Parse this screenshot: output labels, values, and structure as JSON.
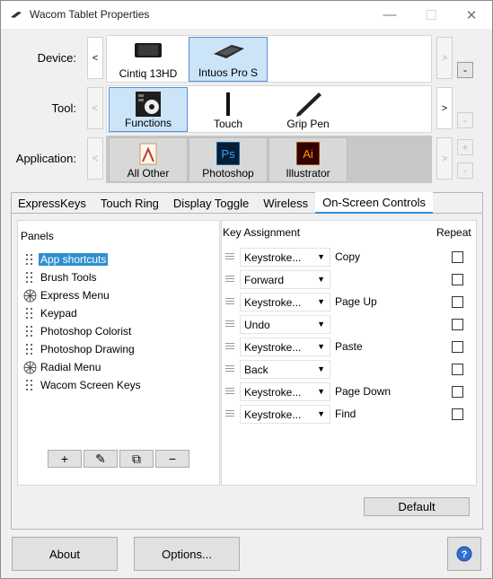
{
  "window": {
    "title": "Wacom Tablet Properties"
  },
  "labels": {
    "device": "Device:",
    "tool": "Tool:",
    "application": "Application:"
  },
  "devices": [
    {
      "label": "Cintiq 13HD",
      "icon": "cintiq-icon",
      "selected": false
    },
    {
      "label": "Intuos Pro S",
      "icon": "intuos-icon",
      "selected": true
    }
  ],
  "tools": [
    {
      "label": "Functions",
      "icon": "functions-icon",
      "selected": true
    },
    {
      "label": "Touch",
      "icon": "touch-icon",
      "selected": false
    },
    {
      "label": "Grip Pen",
      "icon": "pen-icon",
      "selected": false
    }
  ],
  "applications": [
    {
      "label": "All Other",
      "icon": "all-other-icon"
    },
    {
      "label": "Photoshop",
      "icon": "photoshop-icon",
      "abbr": "Ps"
    },
    {
      "label": "Illustrator",
      "icon": "illustrator-icon",
      "abbr": "Ai"
    }
  ],
  "nav": {
    "left": "<",
    "right": ">",
    "minus": "-",
    "plus": "+"
  },
  "tabs": [
    {
      "label": "ExpressKeys",
      "active": false
    },
    {
      "label": "Touch Ring",
      "active": false
    },
    {
      "label": "Display Toggle",
      "active": false
    },
    {
      "label": "Wireless",
      "active": false
    },
    {
      "label": "On-Screen Controls",
      "active": true
    }
  ],
  "panels": {
    "heading": "Panels",
    "items": [
      {
        "label": "App shortcuts",
        "icon": "grid-dots-icon",
        "selected": true
      },
      {
        "label": "Brush Tools",
        "icon": "grid-dots-icon",
        "selected": false
      },
      {
        "label": "Express Menu",
        "icon": "radial-icon",
        "selected": false
      },
      {
        "label": "Keypad",
        "icon": "grid-dots-icon",
        "selected": false
      },
      {
        "label": "Photoshop Colorist",
        "icon": "grid-dots-icon",
        "selected": false
      },
      {
        "label": "Photoshop Drawing",
        "icon": "grid-dots-icon",
        "selected": false
      },
      {
        "label": "Radial Menu",
        "icon": "radial-icon",
        "selected": false
      },
      {
        "label": "Wacom Screen Keys",
        "icon": "grid-dots-icon",
        "selected": false
      }
    ],
    "tool_buttons": [
      "+",
      "✎",
      "⧉",
      "−"
    ]
  },
  "assignments": {
    "key_heading": "Key Assignment",
    "repeat_heading": "Repeat",
    "rows": [
      {
        "value": "Keystroke...",
        "desc": "Copy",
        "repeat": false
      },
      {
        "value": "Forward",
        "desc": "",
        "repeat": false
      },
      {
        "value": "Keystroke...",
        "desc": "Page Up",
        "repeat": false
      },
      {
        "value": "Undo",
        "desc": "",
        "repeat": false
      },
      {
        "value": "Keystroke...",
        "desc": "Paste",
        "repeat": false
      },
      {
        "value": "Back",
        "desc": "",
        "repeat": false
      },
      {
        "value": "Keystroke...",
        "desc": "Page Down",
        "repeat": false
      },
      {
        "value": "Keystroke...",
        "desc": "Find",
        "repeat": false
      }
    ]
  },
  "buttons": {
    "default": "Default",
    "about": "About",
    "options": "Options...",
    "help": "?"
  },
  "colors": {
    "selection": "#2e8fcf",
    "tab_underline": "#2b8fd6",
    "tile_selected": "#cce4f7",
    "help_icon": "#2f6fd0"
  }
}
